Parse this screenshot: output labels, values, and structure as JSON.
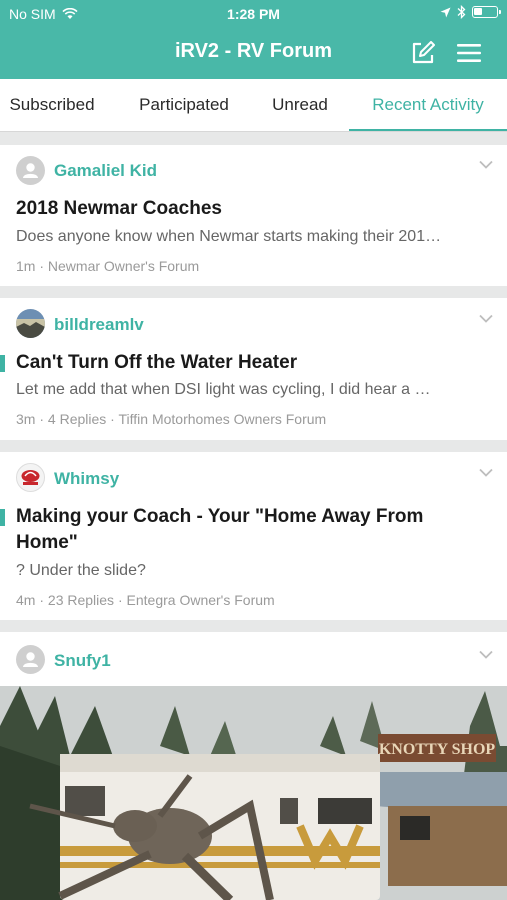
{
  "status": {
    "carrier": "No SIM",
    "time": "1:28 PM"
  },
  "nav": {
    "title": "iRV2 - RV Forum"
  },
  "tabs": [
    {
      "label": "Subscribed"
    },
    {
      "label": "Participated"
    },
    {
      "label": "Unread"
    },
    {
      "label": "Recent Activity"
    }
  ],
  "posts": [
    {
      "author": "Gamaliel Kid",
      "title": "2018 Newmar Coaches",
      "excerpt": "Does anyone know when Newmar starts making their 201…",
      "time": "1m",
      "forum": "Newmar Owner's Forum"
    },
    {
      "author": "billdreamlv",
      "title": "Can't Turn Off the Water Heater",
      "excerpt": "Let me add that when DSI light was cycling, I did hear a …",
      "time": "3m",
      "replies": "4 Replies",
      "forum": "Tiffin Motorhomes Owners Forum"
    },
    {
      "author": "Whimsy",
      "title_line1": "Making your Coach - Your \"Home Away From",
      "title_line2": "Home\"",
      "excerpt": "? Under the slide?",
      "time": "4m",
      "replies": "23 Replies",
      "forum": "Entegra Owner's Forum"
    },
    {
      "author": "Snufy1",
      "photo_sign": "KNOTTY SHOP"
    }
  ],
  "colors": {
    "accent": "#3fb3a4",
    "header": "#49b8a8"
  }
}
